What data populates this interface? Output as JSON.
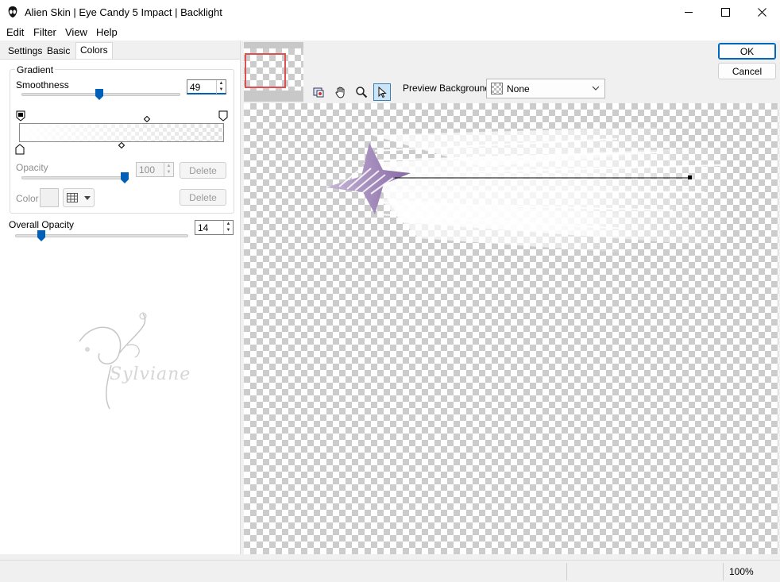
{
  "window": {
    "title": "Alien Skin | Eye Candy 5 Impact | Backlight"
  },
  "menu": {
    "items": [
      {
        "label": "Edit"
      },
      {
        "label": "Filter"
      },
      {
        "label": "View"
      },
      {
        "label": "Help"
      }
    ]
  },
  "tabs": [
    {
      "label": "Settings"
    },
    {
      "label": "Basic"
    },
    {
      "label": "Colors",
      "active": true
    }
  ],
  "gradient": {
    "group_label": "Gradient",
    "smoothness_label": "Smoothness",
    "smoothness_value": "49",
    "opacity_label": "Opacity",
    "opacity_value": "100",
    "delete_label": "Delete",
    "color_label": "Color",
    "delete_label_2": "Delete"
  },
  "overall": {
    "label": "Overall Opacity",
    "value": "14"
  },
  "watermark": {
    "text": "Sylviane"
  },
  "toolbar": {
    "preview_bg_label": "Preview Background:",
    "preview_bg_value": "None"
  },
  "actions": {
    "ok_label": "OK",
    "cancel_label": "Cancel"
  },
  "status": {
    "zoom": "100%"
  },
  "colors": {
    "accent": "#005fb8",
    "star": "#9a7fb4",
    "nav_rect": "#e05050"
  }
}
